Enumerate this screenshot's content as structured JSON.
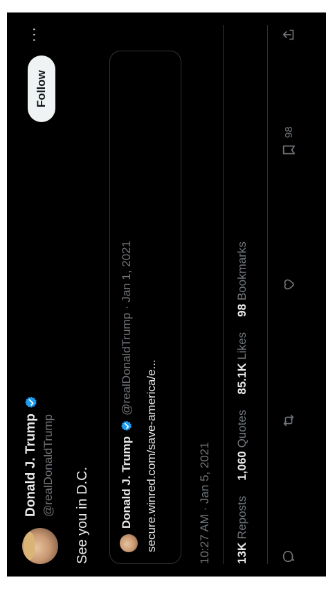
{
  "author": {
    "name": "Donald J. Trump",
    "handle": "@realDonaldTrump"
  },
  "follow_label": "Follow",
  "more_label": "···",
  "tweet_text": "See you in D.C.",
  "quoted": {
    "name": "Donald J. Trump",
    "meta": "@realDonaldTrump · Jan 1, 2021",
    "text": "secure.winred.com/save-america/e..."
  },
  "timestamp": "10:27 AM · Jan 5, 2021",
  "stats": {
    "reposts_count": "13K",
    "reposts_label": "Reposts",
    "quotes_count": "1,060",
    "quotes_label": "Quotes",
    "likes_count": "85.1K",
    "likes_label": "Likes",
    "bookmarks_count": "98",
    "bookmarks_label": "Bookmarks"
  },
  "actions": {
    "bookmark_count": "98"
  },
  "colors": {
    "background": "#000000",
    "text": "#e7e9ea",
    "muted": "#71767b",
    "verified": "#1d9bf0",
    "border": "#2f3336",
    "follow_bg": "#eff3f4"
  },
  "icons": [
    "verified-badge-icon",
    "reply-icon",
    "repost-icon",
    "like-icon",
    "bookmark-icon",
    "share-icon",
    "more-icon"
  ]
}
